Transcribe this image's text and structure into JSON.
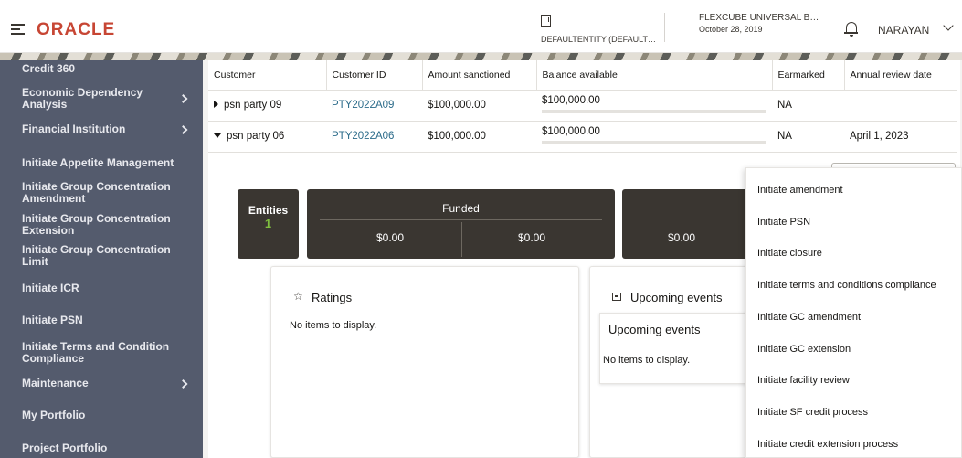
{
  "header": {
    "logo": "ORACLE",
    "entity": "DEFAULTENTITY (DEFAULT…",
    "app_name": "FLEXCUBE UNIVERSAL B…",
    "app_date": "October 28, 2019",
    "user": "NARAYAN"
  },
  "sidebar": {
    "items": [
      {
        "label": "Credit 360"
      },
      {
        "label": "Economic Dependency Analysis"
      },
      {
        "label": "Financial Institution"
      },
      {
        "label": "Initiate Appetite Management"
      },
      {
        "label": "Initiate Group Concentration Amendment"
      },
      {
        "label": "Initiate Group Concentration Extension"
      },
      {
        "label": "Initiate Group Concentration Limit"
      },
      {
        "label": "Initiate ICR"
      },
      {
        "label": "Initiate PSN"
      },
      {
        "label": "Initiate Terms and Condition Compliance"
      },
      {
        "label": "Maintenance"
      },
      {
        "label": "My Portfolio"
      },
      {
        "label": "Project Portfolio"
      }
    ]
  },
  "table": {
    "columns": [
      "Customer",
      "Customer ID",
      "Amount sanctioned",
      "Balance available",
      "Earmarked",
      "Annual review date"
    ],
    "rows": [
      {
        "customer": "psn party 09",
        "customer_id": "PTY2022A09",
        "amount": "$100,000.00",
        "balance": "$100,000.00",
        "earmarked": "NA",
        "review": ""
      },
      {
        "customer": "psn party 06",
        "customer_id": "PTY2022A06",
        "amount": "$100,000.00",
        "balance": "$100,000.00",
        "earmarked": "NA",
        "review": "April 1, 2023"
      }
    ]
  },
  "summary": {
    "entities_label": "Entities",
    "entities_value": "1",
    "funded_label": "Funded",
    "funded_value_1": "$0.00",
    "funded_value_2": "$0.00",
    "tile3_value": "$0.00"
  },
  "ratings": {
    "title": "Ratings",
    "empty": "No items to display."
  },
  "events": {
    "title": "Upcoming events",
    "sub_title": "Upcoming events",
    "empty": "No items to display."
  },
  "menu": {
    "items": [
      "Initiate amendment",
      "Initiate PSN",
      "Initiate closure",
      "Initiate terms and conditions compliance",
      "Initiate GC amendment",
      "Initiate GC extension",
      "Initiate facility review",
      "Initiate SF credit process",
      "Initiate credit extension process"
    ]
  },
  "colors": {
    "brand": "#c74634",
    "sidebar_bg": "#545b6d",
    "tile_bg": "#3a3631",
    "link": "#2b6b8a",
    "entities_value": "#7fbf3f"
  },
  "icons": [
    "hamburger-icon",
    "building-icon",
    "bell-icon",
    "chevron-down-icon",
    "chevron-right-icon",
    "star-icon",
    "calendar-icon",
    "caret-right-icon",
    "caret-down-icon"
  ]
}
